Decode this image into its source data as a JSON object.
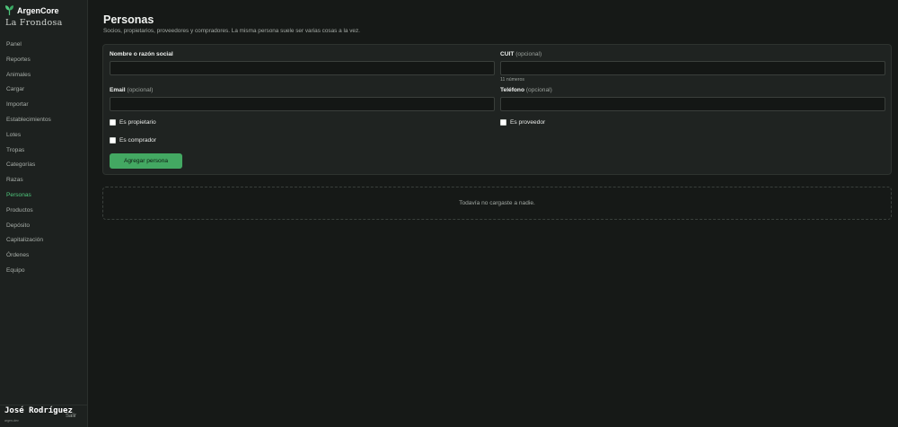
{
  "brand": {
    "name": "ArgenCore",
    "icon": "leaf-icon",
    "accent": "#4fc77c"
  },
  "organization": "La Frondosa",
  "nav": [
    {
      "label": "Panel"
    },
    {
      "label": "Reportes"
    },
    {
      "label": "Animales"
    },
    {
      "label": "Cargar"
    },
    {
      "label": "Importar"
    },
    {
      "label": "Establecimientos"
    },
    {
      "label": "Lotes"
    },
    {
      "label": "Tropas"
    },
    {
      "label": "Categorías"
    },
    {
      "label": "Razas"
    },
    {
      "label": "Personas",
      "active": true
    },
    {
      "label": "Productos"
    },
    {
      "label": "Depósito"
    },
    {
      "label": "Capitalización"
    },
    {
      "label": "Órdenes"
    },
    {
      "label": "Equipo"
    }
  ],
  "user": {
    "name": "José Rodríguez",
    "subtitle": "argen-dev",
    "logout": "Salir"
  },
  "page": {
    "title": "Personas",
    "subtitle": "Socios, propietarios, proveedores y compradores. La misma persona suele ser varias cosas a la vez."
  },
  "form": {
    "name": {
      "label": "Nombre o razón social",
      "value": "",
      "placeholder": ""
    },
    "cuit": {
      "label": "CUIT",
      "optional": "(opcional)",
      "value": "",
      "hint": "11 números"
    },
    "email": {
      "label": "Email",
      "optional": "(opcional)",
      "value": ""
    },
    "phone": {
      "label": "Teléfono",
      "optional": "(opcional)",
      "value": ""
    },
    "checks": {
      "owner": {
        "label": "Es propietario",
        "checked": false
      },
      "buyer": {
        "label": "Es comprador",
        "checked": false
      },
      "supplier": {
        "label": "Es proveedor",
        "checked": false
      }
    },
    "submit": "Agregar persona"
  },
  "empty_state": "Todavía no cargaste a nadie."
}
